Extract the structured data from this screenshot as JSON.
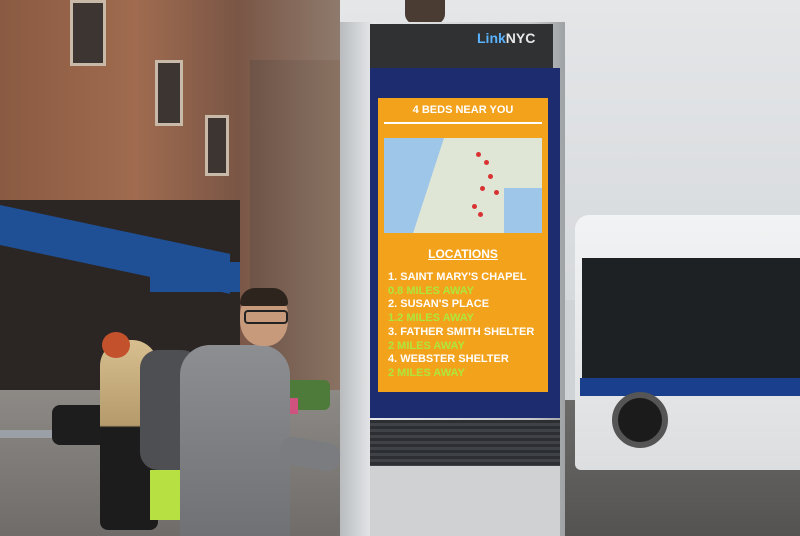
{
  "kiosk": {
    "brand_link": "Link",
    "brand_nyc": "NYC"
  },
  "screen": {
    "title": "4 BEDS NEAR YOU",
    "locations_heading": "LOCATIONS",
    "locations": [
      {
        "name": "1. SAINT MARY'S CHAPEL",
        "distance": "0.8 MILES AWAY"
      },
      {
        "name": "2. SUSAN'S PLACE",
        "distance": "1.2 MILES AWAY"
      },
      {
        "name": "3. FATHER SMITH SHELTER",
        "distance": "2 MILES AWAY"
      },
      {
        "name": "4. WEBSTER SHELTER",
        "distance": "2 MILES AWAY"
      }
    ]
  },
  "colors": {
    "screen_bg": "#f3a21c",
    "distance_text": "#aee73c",
    "kiosk_panel": "#1c2c6e",
    "logo_blue": "#5ab2ff"
  }
}
